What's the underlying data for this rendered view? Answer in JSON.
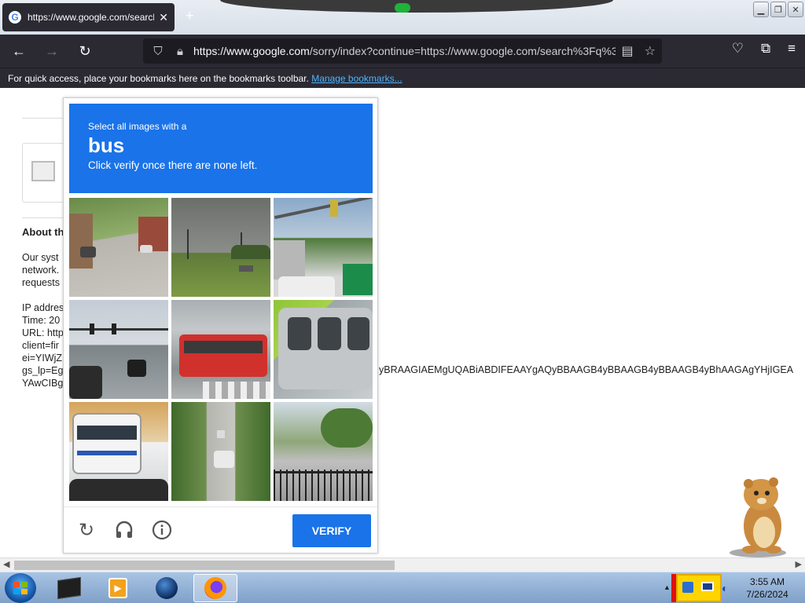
{
  "browser": {
    "tab_title": "https://www.google.com/search",
    "tab_favicon": "G",
    "url_host": "https://www.google.com",
    "url_rest": "/sorry/index?continue=https://www.google.com/search%3Fq%3",
    "bookmarks_text": "For quick access, place your bookmarks here on the bookmarks toolbar.",
    "bookmarks_link": "Manage bookmarks..."
  },
  "page": {
    "about_heading": "About th",
    "para1": [
      "Our syst",
      "network.",
      "requests"
    ],
    "para2": [
      "IP addres",
      "Time: 20",
      "URL: http",
      "client=fir",
      "ei=YIWjZ",
      "gs_lp=Eg",
      "YAwCIBg"
    ],
    "long_line": "yBRAAGIAEMgUQABiABDIFEAAYgAQyBBAAGB4yBBAAGB4yBBAAGB4yBhAAGAgYHjIGEA"
  },
  "captcha": {
    "instruction_line1": "Select all images with a",
    "target": "bus",
    "instruction_line3": "Click verify once there are none left.",
    "verify_label": "VERIFY",
    "colors": {
      "header": "#1a73e8",
      "button": "#1a73e8"
    },
    "tiles": [
      "residential-street",
      "field-road",
      "traffic-light",
      "intersection",
      "red-bus",
      "green-bus",
      "white-bus",
      "tree-lined-road",
      "parking-lot-fence"
    ]
  },
  "taskbar": {
    "time": "3:55 AM",
    "date": "7/26/2024"
  }
}
